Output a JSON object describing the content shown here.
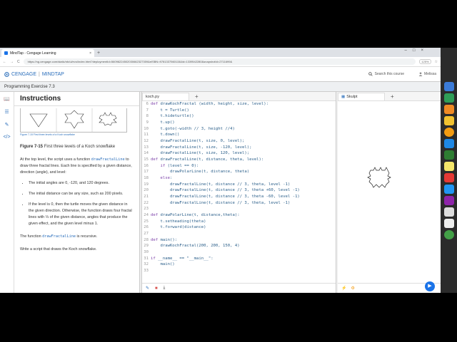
{
  "browser": {
    "tab_title": "MindTap - Cengage Learning",
    "tab_close": "×",
    "new_tab": "+",
    "url": "https://ng.cengage.com/static/nb/ui/evo/index.html?deploymentId=56096224502030662327359&eISBN=9781337560115&id=1339542280&snapshotId=2711699&",
    "zoom": "125%",
    "win_controls": [
      "–",
      "□",
      "×"
    ],
    "nav_back": "←",
    "nav_forward": "→",
    "nav_reload": "C",
    "star": "☆"
  },
  "app": {
    "brand": "CENGAGE",
    "product": "MINDTAP",
    "search_label": "Search this course",
    "user_name": "Melissa",
    "subheader": "Programming Exercise 7.3"
  },
  "instructions": {
    "title": "Instructions",
    "fig_small_caption": "Figure 7-15  First three levels of a Koch snowflake",
    "fig_label": "Figure 7-15",
    "fig_caption": "First three levels of a Koch snowflake",
    "p1_a": "At the top level, the script uses a function",
    "p1_code": "drawFractalLine",
    "p1_b": "to draw three fractal lines. Each line is specified by a given distance, direction (angle), and level:",
    "bullets": [
      "The initial angles are 0, -120, and 120 degrees.",
      "The initial distance can be any size, such as 200 pixels.",
      "If the level is 0, then the turtle moves the given distance in the given direction. Otherwise, the function draws four fractal lines with ⅓ of the given distance, angles that produce the given effect, and the given level minus 1."
    ],
    "p2_a": "The function",
    "p2_code": "drawFractalLine",
    "p2_b": "is recursive.",
    "p3": "Write a script that draws the Koch snowflake."
  },
  "editor": {
    "tab": "koch.py",
    "add_tab": "+",
    "lines": [
      {
        "n": "6",
        "t": "def drawKochFractal (width, height, size, level):"
      },
      {
        "n": "7",
        "t": "    t = Turtle()"
      },
      {
        "n": "8",
        "t": "    t.hideturtle()"
      },
      {
        "n": "9",
        "t": "    t.up()"
      },
      {
        "n": "10",
        "t": "    t.goto(-width // 3, height //4)"
      },
      {
        "n": "11",
        "t": "    t.down()"
      },
      {
        "n": "12",
        "t": "    drawFractalLine(t, size, 0, level);"
      },
      {
        "n": "13",
        "t": "    drawFractalLine(t, size, -120, level);"
      },
      {
        "n": "14",
        "t": "    drawFractalLine(t, size, 120, level);"
      },
      {
        "n": "15",
        "t": "def drawFractalLine(t, distance, theta, level):"
      },
      {
        "n": "16",
        "t": "    if (level == 0):"
      },
      {
        "n": "17",
        "t": "        drawPolarLine(t, distance, theta)"
      },
      {
        "n": "18",
        "t": "    else:"
      },
      {
        "n": "19",
        "t": "        drawFractalLine(t, distance // 3, theta, level -1)"
      },
      {
        "n": "20",
        "t": "        drawFractalLine(t, distance // 3, theta +60, level -1)"
      },
      {
        "n": "21",
        "t": "        drawFractalLine(t, distance // 3, theta -60, level -1)"
      },
      {
        "n": "22",
        "t": "        drawFractalLine(t, distance // 3, theta, level -1)"
      },
      {
        "n": "23",
        "t": ""
      },
      {
        "n": "24",
        "t": "def drawPolarLine(t, distance,theta):"
      },
      {
        "n": "25",
        "t": "    t.setheading(theta)"
      },
      {
        "n": "26",
        "t": "    t.forward(distance)"
      },
      {
        "n": "27",
        "t": ""
      },
      {
        "n": "28",
        "t": "def main():"
      },
      {
        "n": "29",
        "t": "    drawKochFractal(200, 200, 150, 4)"
      },
      {
        "n": "30",
        "t": ""
      },
      {
        "n": "31",
        "t": "if __name__ == \"__main__\":"
      },
      {
        "n": "32",
        "t": "    main()"
      },
      {
        "n": "33",
        "t": ""
      }
    ]
  },
  "output": {
    "tab": "Skulpt",
    "add_tab": "+",
    "play": "▶"
  },
  "colors": {
    "accent": "#2a6ebb",
    "keyword": "#7a3ea8",
    "play_button": "#1a73e8"
  }
}
